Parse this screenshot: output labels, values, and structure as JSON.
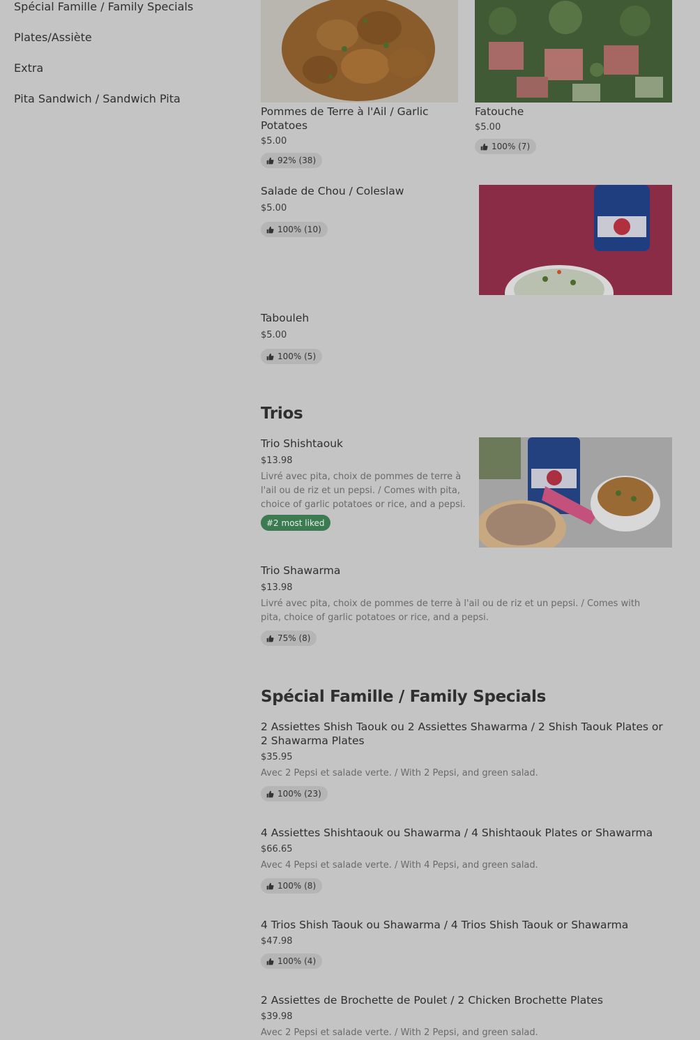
{
  "sidebar": {
    "items": [
      {
        "label": "Spécial Famille / Family Specials"
      },
      {
        "label": "Plates/Assiète"
      },
      {
        "label": "Extra"
      },
      {
        "label": "Pita Sandwich / Sandwich Pita"
      }
    ]
  },
  "items": {
    "garlic_potatoes": {
      "title": "Pommes de Terre à l'Ail / Garlic Potatoes",
      "price": "$5.00",
      "rating": "92% (38)"
    },
    "fatouche": {
      "title": "Fatouche",
      "price": "$5.00",
      "rating": "100% (7)"
    },
    "coleslaw": {
      "title": "Salade de Chou / Coleslaw",
      "price": "$5.00",
      "rating": "100% (10)"
    },
    "tabouleh": {
      "title": "Tabouleh",
      "price": "$5.00",
      "rating": "100% (5)"
    }
  },
  "sections": {
    "trios": {
      "title": "Trios",
      "items": [
        {
          "title": "Trio Shishtaouk",
          "price": "$13.98",
          "desc": "Livré avec pita, choix de pommes de terre à l'ail ou de riz et un pepsi. / Comes with pita, choice of garlic potatoes or rice, and a pepsi.",
          "badge": "#2 most liked"
        },
        {
          "title": "Trio Shawarma",
          "price": "$13.98",
          "desc": "Livré avec pita, choix de pommes de terre à l'ail ou de riz et un pepsi. / Comes with pita, choice of garlic potatoes or rice, and a pepsi.",
          "rating": "75% (8)"
        }
      ]
    },
    "family": {
      "title": "Spécial Famille / Family Specials",
      "items": [
        {
          "title": "2 Assiettes Shish Taouk ou 2 Assiettes Shawarma / 2 Shish Taouk Plates or 2 Shawarma Plates",
          "price": "$35.95",
          "desc": "Avec 2 Pepsi et salade verte. / With 2 Pepsi, and green salad.",
          "rating": "100% (23)"
        },
        {
          "title": "4 Assiettes Shishtaouk ou Shawarma / 4 Shishtaouk Plates or Shawarma",
          "price": "$66.65",
          "desc": "Avec 4 Pepsi et salade verte. / With 4 Pepsi, and green salad.",
          "rating": "100% (8)"
        },
        {
          "title": "4 Trios Shish Taouk ou Shawarma / 4 Trios Shish Taouk or Shawarma",
          "price": "$47.98",
          "rating": "100% (4)"
        },
        {
          "title": "2 Assiettes de Brochette de Poulet / 2 Chicken Brochette Plates",
          "price": "$39.98",
          "desc": "Avec 2 Pepsi et salade verte. / With 2 Pepsi, and green salad."
        }
      ]
    }
  },
  "icons": {
    "rating": "thumbs-up-icon"
  },
  "colors": {
    "background": "#c4c4c4",
    "badge": "#b5b5b5",
    "most_liked": "#3c7a52"
  }
}
